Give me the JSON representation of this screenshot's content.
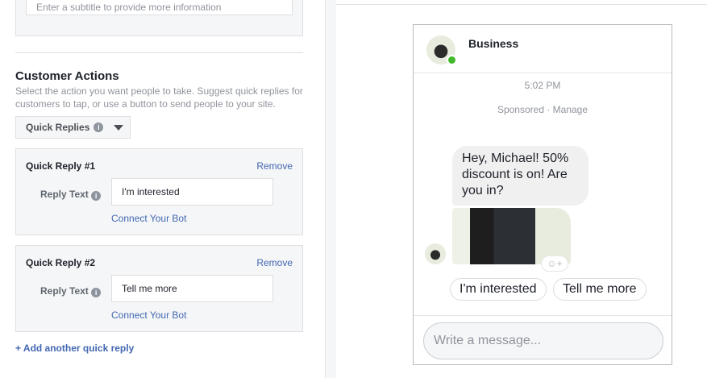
{
  "subtitle_placeholder": "Enter a subtitle to provide more information",
  "customer_actions": {
    "title": "Customer Actions",
    "description_1": "Select the action you want people to take. Suggest quick replies for",
    "description_2": "customers to tap, or use a button to send people to your site.",
    "dropdown": "Quick Replies"
  },
  "quick_replies": [
    {
      "title": "Quick Reply #1",
      "remove": "Remove",
      "field_label": "Reply Text",
      "value": "I'm interested",
      "connect": "Connect Your Bot"
    },
    {
      "title": "Quick Reply #2",
      "remove": "Remove",
      "field_label": "Reply Text",
      "value": "Tell me more",
      "connect": "Connect Your Bot"
    }
  ],
  "add_reply": "+ Add another quick reply",
  "preview": {
    "name": "Business",
    "time": "5:02 PM",
    "sponsored": "Sponsored · Manage",
    "message": "Hey, Michael! 50% discount is on! Are you in?",
    "replies": [
      "I'm interested",
      "Tell me more"
    ],
    "composer_placeholder": "Write a message..."
  }
}
